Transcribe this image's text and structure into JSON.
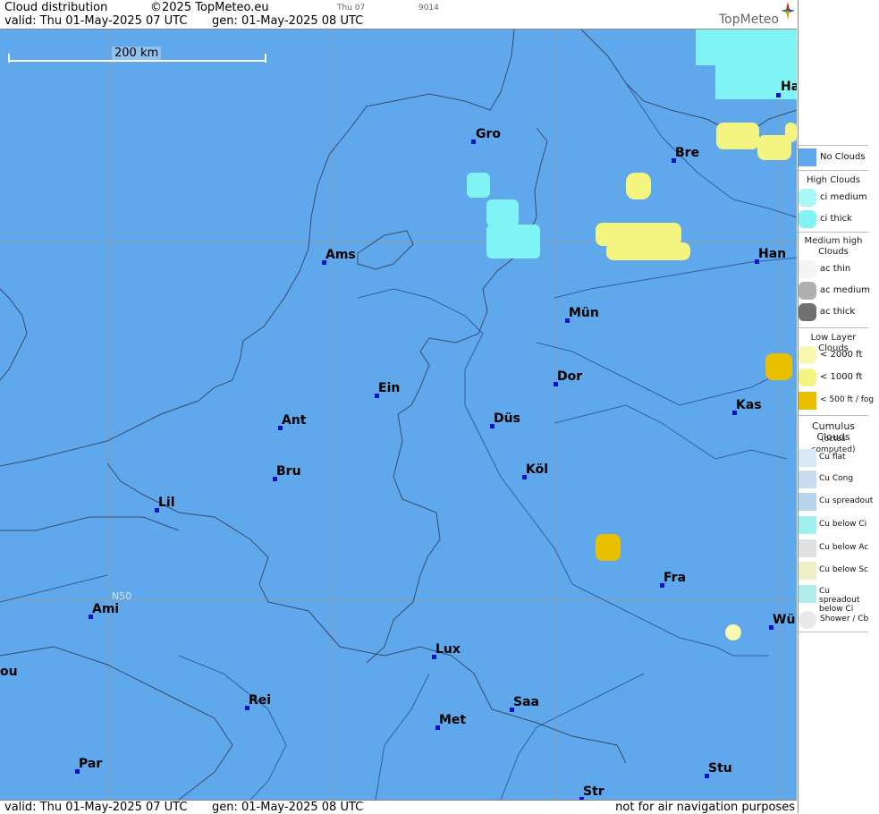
{
  "header": {
    "title": "Cloud distribution",
    "copyright": "©2025 TopMeteo.eu",
    "valid": "valid:  Thu  01-May-2025  07 UTC",
    "gen": "gen: 01-May-2025 08 UTC",
    "small_day": "Thu 07",
    "small_code": "9014",
    "logo": "TopMeteo"
  },
  "map": {
    "scale_label": "200 km",
    "lat_label": "N50",
    "cities": [
      {
        "name": "Gro"
      },
      {
        "name": "Bre"
      },
      {
        "name": "Ha"
      },
      {
        "name": "Ams"
      },
      {
        "name": "Han"
      },
      {
        "name": "Mün"
      },
      {
        "name": "Dor"
      },
      {
        "name": "Ein"
      },
      {
        "name": "Ant"
      },
      {
        "name": "Düs"
      },
      {
        "name": "Kas"
      },
      {
        "name": "Bru"
      },
      {
        "name": "Köl"
      },
      {
        "name": "Lil"
      },
      {
        "name": "Fra"
      },
      {
        "name": "Ami"
      },
      {
        "name": "Wü"
      },
      {
        "name": "Lux"
      },
      {
        "name": "ou"
      },
      {
        "name": "Rei"
      },
      {
        "name": "Saa"
      },
      {
        "name": "Met"
      },
      {
        "name": "Par"
      },
      {
        "name": "Stu"
      },
      {
        "name": "Str"
      }
    ]
  },
  "footer": {
    "valid": "valid:  Thu  01-May-2025  07 UTC",
    "gen": "gen: 01-May-2025 08 UTC",
    "note": "not for air navigation purposes"
  },
  "legend": {
    "no_clouds": "No Clouds",
    "high_title": "High Clouds",
    "ci_medium": "ci medium",
    "ci_thick": "ci thick",
    "medium_title": "Medium high Clouds",
    "ac_thin": "ac thin",
    "ac_medium": "ac medium",
    "ac_thick": "ac thick",
    "low_title": "Low Layer Clouds",
    "lt2000": "< 2000 ft",
    "lt1000": "< 1000 ft",
    "lt500": "< 500 ft / fog",
    "cu_title": "Cumulus Clouds",
    "cu_sub": "(octas computed)",
    "cu_flat": "Cu flat",
    "cu_cong": "Cu Cong",
    "cu_spreadout": "Cu spreadout",
    "cu_below_ci": "Cu below Ci",
    "cu_below_ac": "Cu below Ac",
    "cu_below_sc": "Cu below Sc",
    "cu_spread_below_ci": "Cu spreadout below Ci",
    "shower": "Shower / Cb",
    "colors": {
      "no_clouds": "#60a8ec",
      "ci_medium": "#a8f8f8",
      "ci_thick": "#80f4f4",
      "lt2000": "#f8f8b0",
      "lt1000": "#f4f480",
      "lt500": "#e8c000"
    }
  }
}
